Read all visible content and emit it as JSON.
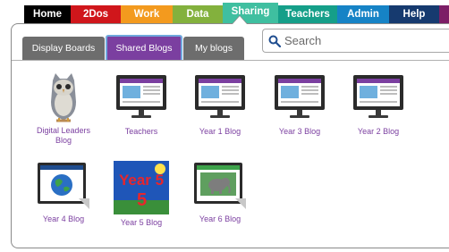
{
  "nav": {
    "tabs": [
      {
        "label": "Home",
        "color": "#000000"
      },
      {
        "label": "2Dos",
        "color": "#d0161b"
      },
      {
        "label": "Work",
        "color": "#f39a1e"
      },
      {
        "label": "Data",
        "color": "#83b13d"
      },
      {
        "label": "Sharing",
        "color": "#3fbfa0"
      },
      {
        "label": "Teachers",
        "color": "#159f89"
      },
      {
        "label": "Admin",
        "color": "#1683c6"
      },
      {
        "label": "Help",
        "color": "#163a6f"
      }
    ]
  },
  "subtabs": [
    {
      "label": "Display Boards"
    },
    {
      "label": "Shared Blogs"
    },
    {
      "label": "My blogs"
    }
  ],
  "search": {
    "placeholder": "Search",
    "icon": "search-icon"
  },
  "blogs": [
    {
      "label": "Digital Leaders Blog",
      "icon": "owl-icon"
    },
    {
      "label": "Teachers",
      "icon": "monitor-blog-icon"
    },
    {
      "label": "Year 1 Blog",
      "icon": "monitor-blog-icon"
    },
    {
      "label": "Year 3 Blog",
      "icon": "monitor-blog-icon"
    },
    {
      "label": "Year 2 Blog",
      "icon": "monitor-blog-icon"
    },
    {
      "label": "Year 4 Blog",
      "icon": "earth-document-icon"
    },
    {
      "label": "Year 5 Blog",
      "icon": "year-5-image-icon",
      "image_text": "Year 5"
    },
    {
      "label": "Year 6 Blog",
      "icon": "elephant-document-icon"
    }
  ],
  "colors": {
    "accent": "#7b3fa0",
    "subtab_bg": "#6d6d6d",
    "active_subtab_border": "#6fa8dc"
  }
}
